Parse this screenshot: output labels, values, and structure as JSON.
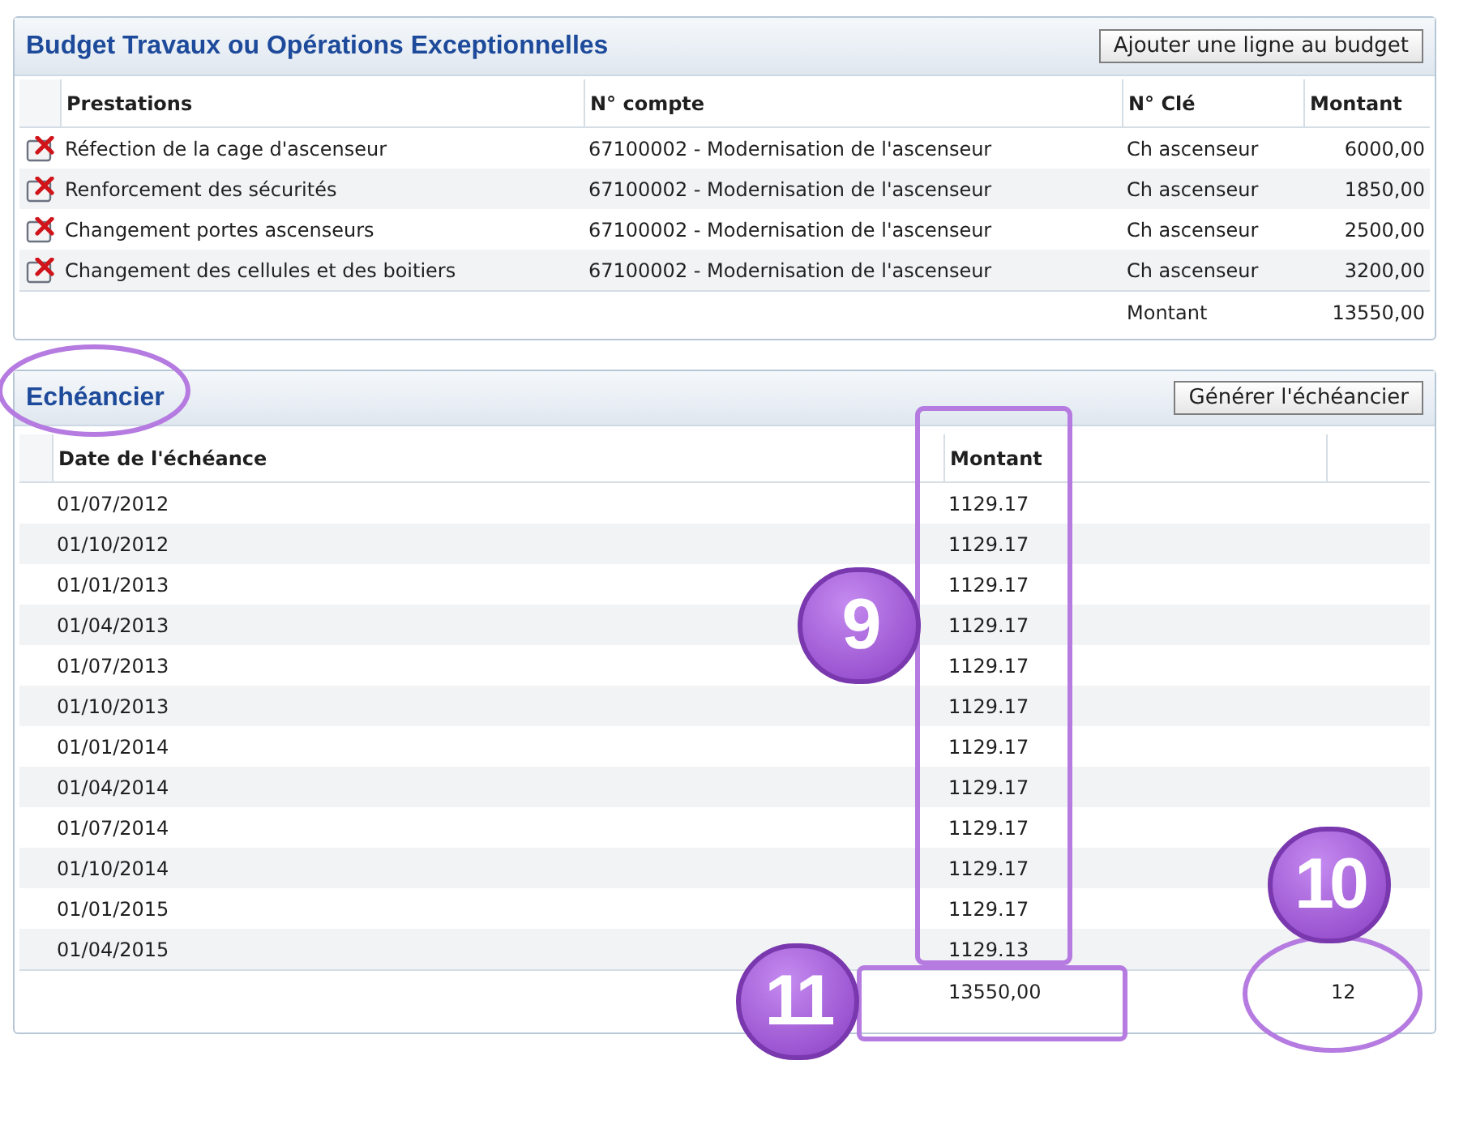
{
  "budget": {
    "title": "Budget Travaux ou Opérations Exceptionnelles",
    "add_button": "Ajouter une ligne au budget",
    "columns": [
      "Prestations",
      "N° compte",
      "N° Clé",
      "Montant"
    ],
    "rows": [
      {
        "prestation": "Réfection de la cage d'ascenseur",
        "compte": "67100002 - Modernisation de l'ascenseur",
        "cle": "Ch ascenseur",
        "montant": "6000,00"
      },
      {
        "prestation": "Renforcement des sécurités",
        "compte": "67100002 - Modernisation de l'ascenseur",
        "cle": "Ch ascenseur",
        "montant": "1850,00"
      },
      {
        "prestation": "Changement portes ascenseurs",
        "compte": "67100002 - Modernisation de l'ascenseur",
        "cle": "Ch ascenseur",
        "montant": "2500,00"
      },
      {
        "prestation": "Changement des cellules et des boitiers",
        "compte": "67100002 - Modernisation de l'ascenseur",
        "cle": "Ch ascenseur",
        "montant": "3200,00"
      }
    ],
    "total_label": "Montant",
    "total": "13550,00"
  },
  "echeancier": {
    "title": "Echéancier",
    "generate_button": "Générer l'échéancier",
    "columns": [
      "Date de l'échéance",
      "Montant"
    ],
    "rows": [
      {
        "date": "01/07/2012",
        "montant": "1129.17"
      },
      {
        "date": "01/10/2012",
        "montant": "1129.17"
      },
      {
        "date": "01/01/2013",
        "montant": "1129.17"
      },
      {
        "date": "01/04/2013",
        "montant": "1129.17"
      },
      {
        "date": "01/07/2013",
        "montant": "1129.17"
      },
      {
        "date": "01/10/2013",
        "montant": "1129.17"
      },
      {
        "date": "01/01/2014",
        "montant": "1129.17"
      },
      {
        "date": "01/04/2014",
        "montant": "1129.17"
      },
      {
        "date": "01/07/2014",
        "montant": "1129.17"
      },
      {
        "date": "01/10/2014",
        "montant": "1129.17"
      },
      {
        "date": "01/01/2015",
        "montant": "1129.17"
      },
      {
        "date": "01/04/2015",
        "montant": "1129.13"
      }
    ],
    "total": "13550,00",
    "count": "12"
  },
  "callouts": [
    {
      "label": "9"
    },
    {
      "label": "10"
    },
    {
      "label": "11"
    }
  ]
}
